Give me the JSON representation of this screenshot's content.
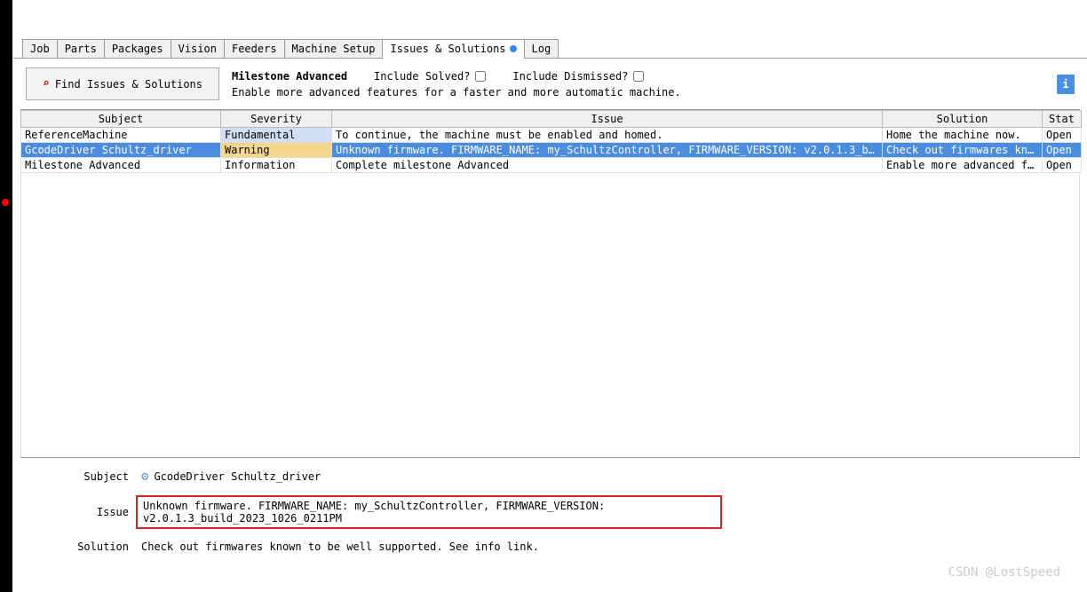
{
  "tabs": {
    "job": "Job",
    "parts": "Parts",
    "packages": "Packages",
    "vision": "Vision",
    "feeders": "Feeders",
    "machine_setup": "Machine Setup",
    "issues_solutions": "Issues & Solutions",
    "log": "Log"
  },
  "toolbar": {
    "find_label": "Find Issues & Solutions",
    "milestone_label": "Milestone Advanced",
    "include_solved": "Include Solved?",
    "include_dismissed": "Include Dismissed?",
    "description": "Enable more advanced features for a faster and more automatic machine."
  },
  "table": {
    "headers": {
      "subject": "Subject",
      "severity": "Severity",
      "issue": "Issue",
      "solution": "Solution",
      "status": "Stat"
    },
    "rows": [
      {
        "subject": "ReferenceMachine",
        "severity": "Fundamental",
        "severity_class": "sev-fundamental",
        "issue": "To continue, the machine must be enabled and homed.",
        "solution": "Home the machine now.",
        "status": "Open"
      },
      {
        "subject": "GcodeDriver Schultz_driver",
        "severity": "Warning",
        "severity_class": "sev-warning",
        "issue": "Unknown firmware. FIRMWARE_NAME: my_SchultzController, FIRMWARE_VERSION: v2.0.1.3_build_2023_1026_02...",
        "solution": "Check out firmwares known ...",
        "status": "Open",
        "selected": true
      },
      {
        "subject": "Milestone Advanced",
        "severity": "Information",
        "severity_class": "",
        "issue": "Complete milestone Advanced",
        "solution": "Enable more advanced featu...",
        "status": "Open"
      }
    ]
  },
  "detail": {
    "subject_label": "Subject",
    "subject_value": "GcodeDriver Schultz_driver",
    "issue_label": "Issue",
    "issue_value": "Unknown firmware. FIRMWARE_NAME: my_SchultzController, FIRMWARE_VERSION: v2.0.1.3_build_2023_1026_0211PM",
    "solution_label": "Solution",
    "solution_value": "Check out firmwares known to be well supported. See info link."
  },
  "watermark": "CSDN @LostSpeed"
}
